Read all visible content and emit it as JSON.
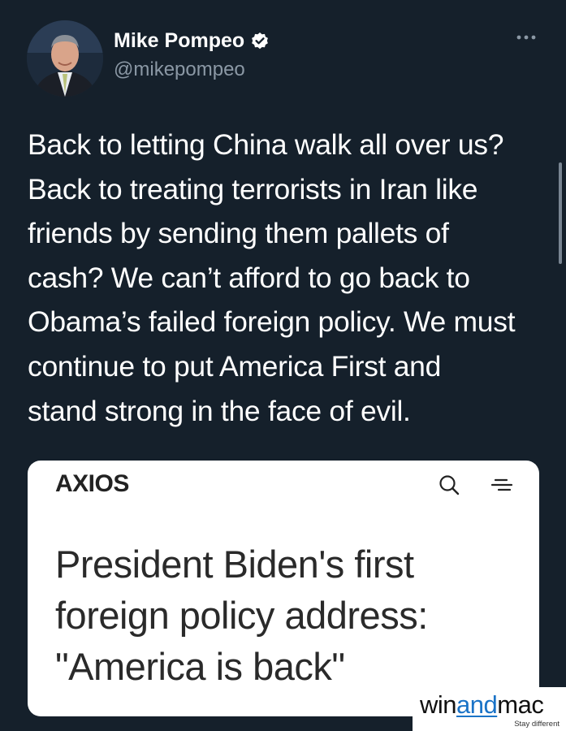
{
  "tweet": {
    "display_name": "Mike Pompeo",
    "handle": "@mikepompeo",
    "verified_icon": "verified-badge-icon",
    "more_icon": "more-options-icon",
    "text": "Back to letting China walk all over us?\nBack to treating terrorists in Iran like\nfriends by sending them pallets of\ncash? We can’t afford to go back to\nObama’s failed foreign policy. We must\ncontinue to put America First and\nstand strong in the face of evil."
  },
  "card": {
    "brand": "AXIOS",
    "search_icon": "search-icon",
    "menu_icon": "menu-icon",
    "headline": "President Biden's first\nforeign policy address:\n\"America is back\""
  },
  "watermark": {
    "prefix": "win",
    "highlight": "and",
    "suffix": "mac",
    "tagline": "Stay different"
  },
  "colors": {
    "background": "#15202b",
    "text": "#ffffff",
    "secondary": "#8b98a5",
    "verified": "#ffffff",
    "card_bg": "#ffffff",
    "headline": "#2a2a2a",
    "watermark_accent": "#1a73c7"
  }
}
